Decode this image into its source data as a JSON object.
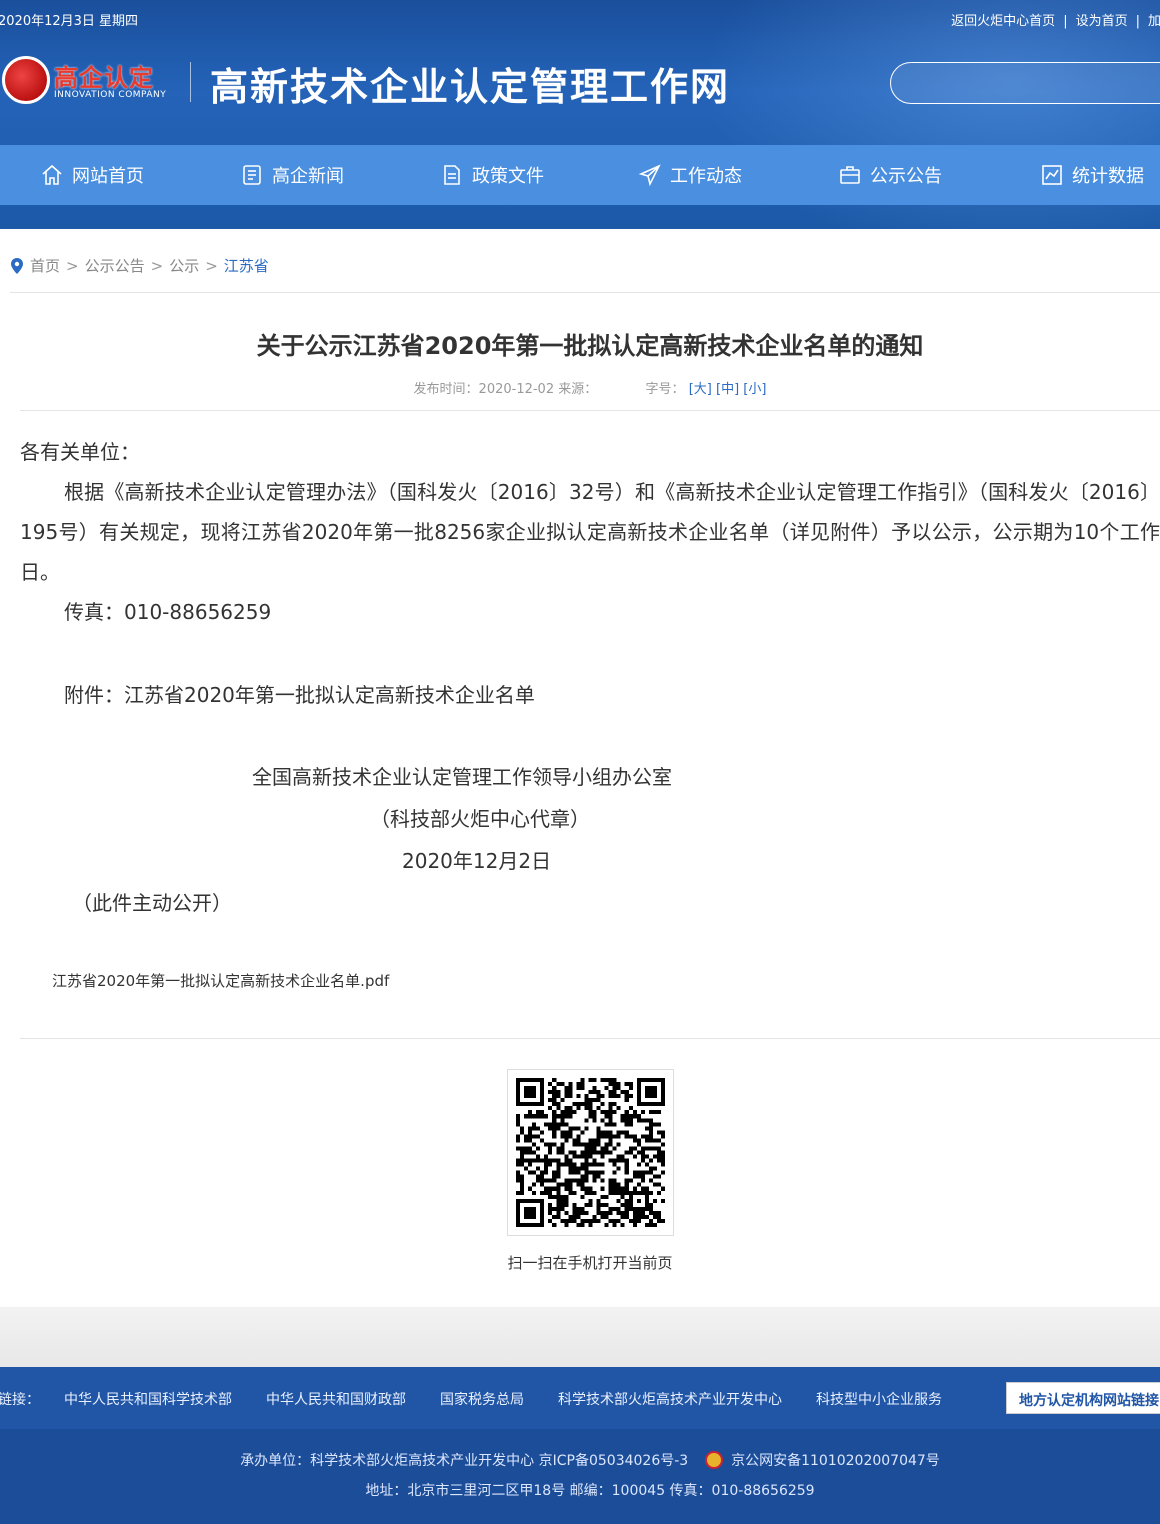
{
  "topbar": {
    "date": "2020年12月3日 星期四",
    "links": [
      "返回火炬中心首页",
      "设为首页",
      "加入收藏"
    ]
  },
  "logo": {
    "cn": "高企认定",
    "en": "INNOVATION COMPANY"
  },
  "site_title": "高新技术企业认定管理工作网",
  "search": {
    "placeholder": ""
  },
  "nav": [
    {
      "label": "网站首页",
      "icon": "home-icon"
    },
    {
      "label": "高企新闻",
      "icon": "news-icon"
    },
    {
      "label": "政策文件",
      "icon": "document-icon"
    },
    {
      "label": "工作动态",
      "icon": "paper-plane-icon"
    },
    {
      "label": "公示公告",
      "icon": "briefcase-icon"
    },
    {
      "label": "统计数据",
      "icon": "chart-icon"
    }
  ],
  "breadcrumb": {
    "items": [
      "首页",
      "公示公告",
      "公示"
    ],
    "current": "江苏省",
    "separator": ">"
  },
  "article": {
    "title": "关于公示江苏省2020年第一批拟认定高新技术企业名单的通知",
    "meta_publish_label": "发布时间：",
    "meta_publish_date": "2020-12-02",
    "meta_source_label": "来源：",
    "meta_font_label": "字号：",
    "meta_font_sizes": [
      "[大]",
      "[中]",
      "[小]"
    ],
    "salutation": "各有关单位：",
    "main": "根据《高新技术企业认定管理办法》（国科发火〔2016〕32号）和《高新技术企业认定管理工作指引》（国科发火〔2016〕195号）有关规定，现将江苏省2020年第一批8256家企业拟认定高新技术企业名单（详见附件）予以公示，公示期为10个工作日。",
    "fax": "传真：010-88656259",
    "attachment": "附件：江苏省2020年第一批拟认定高新技术企业名单",
    "org": "全国高新技术企业认定管理工作领导小组办公室",
    "chapter": "（科技部火炬中心代章）",
    "date": "2020年12月2日",
    "public_note": "（此件主动公开）",
    "attachment_file": "江苏省2020年第一批拟认定高新技术企业名单.pdf"
  },
  "qr": {
    "caption": "扫一扫在手机打开当前页"
  },
  "footer": {
    "related_label": "相关链接：",
    "links": [
      "中华人民共和国科学技术部",
      "中华人民共和国财政部",
      "国家税务总局",
      "科学技术部火炬高技术产业开发中心",
      "科技型中小企业服务"
    ],
    "local_button": "地方认定机构网站链接",
    "row1_prefix": "承办单位：科学技术部火炬高技术产业开发中心 京ICP备05034026号-3",
    "row1_police": "京公网安备11010202007047号",
    "row2": "地址：北京市三里河二区甲18号 邮编：100045 传真：010-88656259"
  }
}
